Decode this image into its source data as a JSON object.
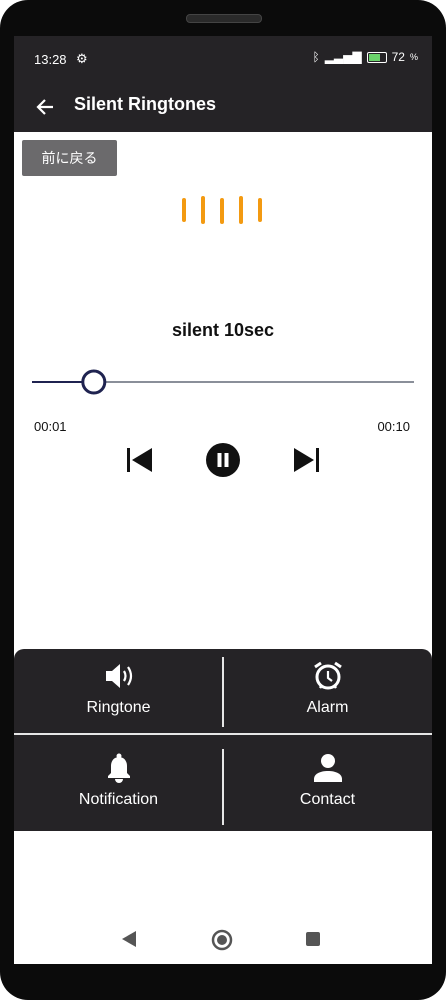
{
  "status": {
    "time": "13:28",
    "battery": "72"
  },
  "appbar": {
    "title": "Silent Ringtones"
  },
  "back_jp_label": "前に戻る",
  "player": {
    "track_title": "silent 10sec",
    "time_current": "00:01",
    "time_total": "00:10",
    "progress": 0.1,
    "accent": "#f39a11",
    "knob_color": "#1f2350"
  },
  "actions": [
    {
      "label": "Ringtone",
      "icon": "speaker-icon"
    },
    {
      "label": "Alarm",
      "icon": "alarm-clock-icon"
    },
    {
      "label": "Notification",
      "icon": "bell-icon"
    },
    {
      "label": "Contact",
      "icon": "person-icon"
    }
  ]
}
